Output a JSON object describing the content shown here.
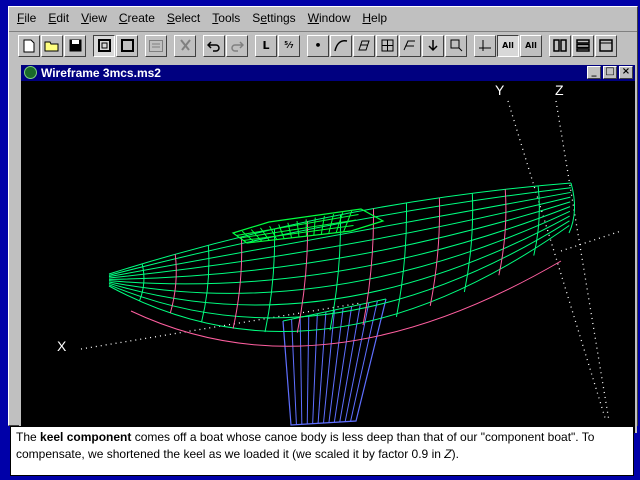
{
  "menu": [
    {
      "pre": "",
      "u": "F",
      "post": "ile"
    },
    {
      "pre": "",
      "u": "E",
      "post": "dit"
    },
    {
      "pre": "",
      "u": "V",
      "post": "iew"
    },
    {
      "pre": "",
      "u": "C",
      "post": "reate"
    },
    {
      "pre": "",
      "u": "S",
      "post": "elect"
    },
    {
      "pre": "",
      "u": "T",
      "post": "ools"
    },
    {
      "pre": "S",
      "u": "e",
      "post": "ttings"
    },
    {
      "pre": "",
      "u": "W",
      "post": "indow"
    },
    {
      "pre": "",
      "u": "H",
      "post": "elp"
    }
  ],
  "toolbar": {
    "new_icon": "new-document-icon",
    "open_icon": "open-folder-icon",
    "save_icon": "save-disk-icon",
    "undo_icon": "undo-icon",
    "redo_icon": "redo-icon",
    "line_label": "L",
    "fraction_label": "⁵⁄₇",
    "point_label": "•",
    "allsel_label": "All",
    "allsel2_label": "All"
  },
  "child_window": {
    "title": "Wireframe 3mcs.ms2",
    "min_label": "_",
    "max_label": "□",
    "close_label": "×"
  },
  "viewport": {
    "axis_y": "Y",
    "axis_z": "Z",
    "axis_x": "X",
    "colors": {
      "background": "#000000",
      "hull_lines": "#00ff80",
      "stations": "#ff5fa0",
      "keel": "#5f6fff",
      "deck": "#00ff40",
      "axes": "#ffffff"
    }
  },
  "caption": {
    "pre": "The ",
    "bold": "keel component",
    "mid": " comes off a boat whose canoe body is less deep than that of our \"component boat\". To compensate, we shortened the keel as we loaded it (we scaled it by factor 0.9 in ",
    "italic": "Z",
    "post": ")."
  }
}
